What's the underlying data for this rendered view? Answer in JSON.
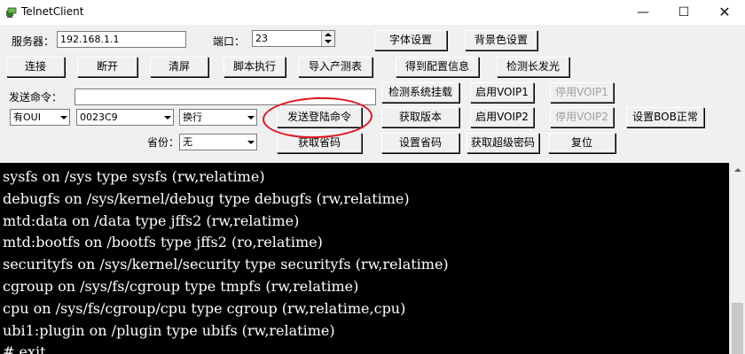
{
  "window": {
    "title": "TelnetClient",
    "minimize": "—",
    "maximize": "☐",
    "close": "✕"
  },
  "connection": {
    "server_label": "服务器：",
    "server_value": "192.168.1.1",
    "port_label": "端口：",
    "port_value": "23",
    "font_settings": "字体设置",
    "bg_color_settings": "背景色设置"
  },
  "toolbar": {
    "connect": "连接",
    "disconnect": "断开",
    "clear_screen": "清屏",
    "run_script": "脚本执行",
    "import_product_table": "导入产测表",
    "get_config_info": "得到配置信息",
    "detect_long_led": "检测长发光"
  },
  "command": {
    "send_cmd_label": "发送命令：",
    "send_cmd_value": "",
    "oui_select": "有OUI",
    "code_select": "0023C9",
    "newline_select": "换行",
    "send_login_cmd": "发送登陆命令",
    "province_label": "省份：",
    "province_select": "无",
    "get_province": "获取省码"
  },
  "actions": {
    "detect_system_mount": "检测系统挂载",
    "enable_voip1": "启用VOIP1",
    "disable_voip1": "停用VOIP1",
    "get_version": "获取版本",
    "enable_voip2": "启用VOIP2",
    "disable_voip2": "停用VOIP2",
    "set_bob_normal": "设置BOB正常",
    "set_province": "设置省码",
    "get_super_password": "获取超级密码",
    "reset": "复位"
  },
  "console": {
    "lines": [
      "sysfs on /sys type sysfs (rw,relatime)",
      "debugfs on /sys/kernel/debug type debugfs (rw,relatime)",
      "mtd:data on /data type jffs2 (rw,relatime)",
      "mtd:bootfs on /bootfs type jffs2 (ro,relatime)",
      "securityfs on /sys/kernel/security type securityfs (rw,relatime)",
      "cgroup on /sys/fs/cgroup type tmpfs (rw,relatime)",
      "cpu on /sys/fs/cgroup/cpu type cgroup (rw,relatime,cpu)",
      "ubi1:plugin on /plugin type ubifs (rw,relatime)",
      "# exit"
    ]
  },
  "colors": {
    "console_bg": "#000000",
    "console_fg": "#ffffff",
    "annotation_circle": "#e0141e"
  },
  "icons": {
    "app": "telnet-app-icon"
  }
}
